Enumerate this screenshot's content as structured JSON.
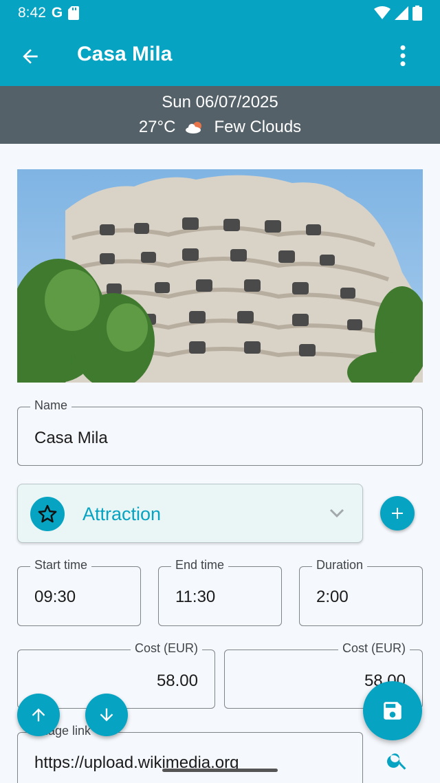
{
  "status_bar": {
    "time": "8:42",
    "icons": [
      "google-icon",
      "sd-card-icon",
      "wifi-icon",
      "signal-icon",
      "battery-icon"
    ]
  },
  "app_bar": {
    "title": "Casa Mila",
    "back_icon": "arrow-left-icon",
    "menu_icon": "more-vert-icon"
  },
  "info_bar": {
    "date": "Sun 06/07/2025",
    "temperature": "27°C",
    "weather_icon": "partly-cloudy-icon",
    "weather": "Few Clouds"
  },
  "photo": {
    "description_icon": "building-photo"
  },
  "form": {
    "name": {
      "label": "Name",
      "value": "Casa Mila"
    },
    "category": {
      "value": "Attraction",
      "icon": "star-icon"
    },
    "add_icon": "plus-icon",
    "start_time": {
      "label": "Start time",
      "value": "09:30"
    },
    "end_time": {
      "label": "End time",
      "value": "11:30"
    },
    "duration": {
      "label": "Duration",
      "value": "2:00"
    },
    "cost_1": {
      "label": "Cost (EUR)",
      "value": "58.00"
    },
    "cost_2": {
      "label": "Cost (EUR)",
      "value": "58.00"
    },
    "image_link": {
      "label": "Image link",
      "value": "https://upload.wikimedia.org"
    }
  },
  "fabs": {
    "move_up_icon": "arrow-up-icon",
    "move_down_icon": "arrow-down-icon",
    "save_icon": "save-icon",
    "search_icon": "search-icon"
  },
  "colors": {
    "primary": "#06a3c2",
    "info_bar": "#546169",
    "background": "#f5f8fc"
  }
}
